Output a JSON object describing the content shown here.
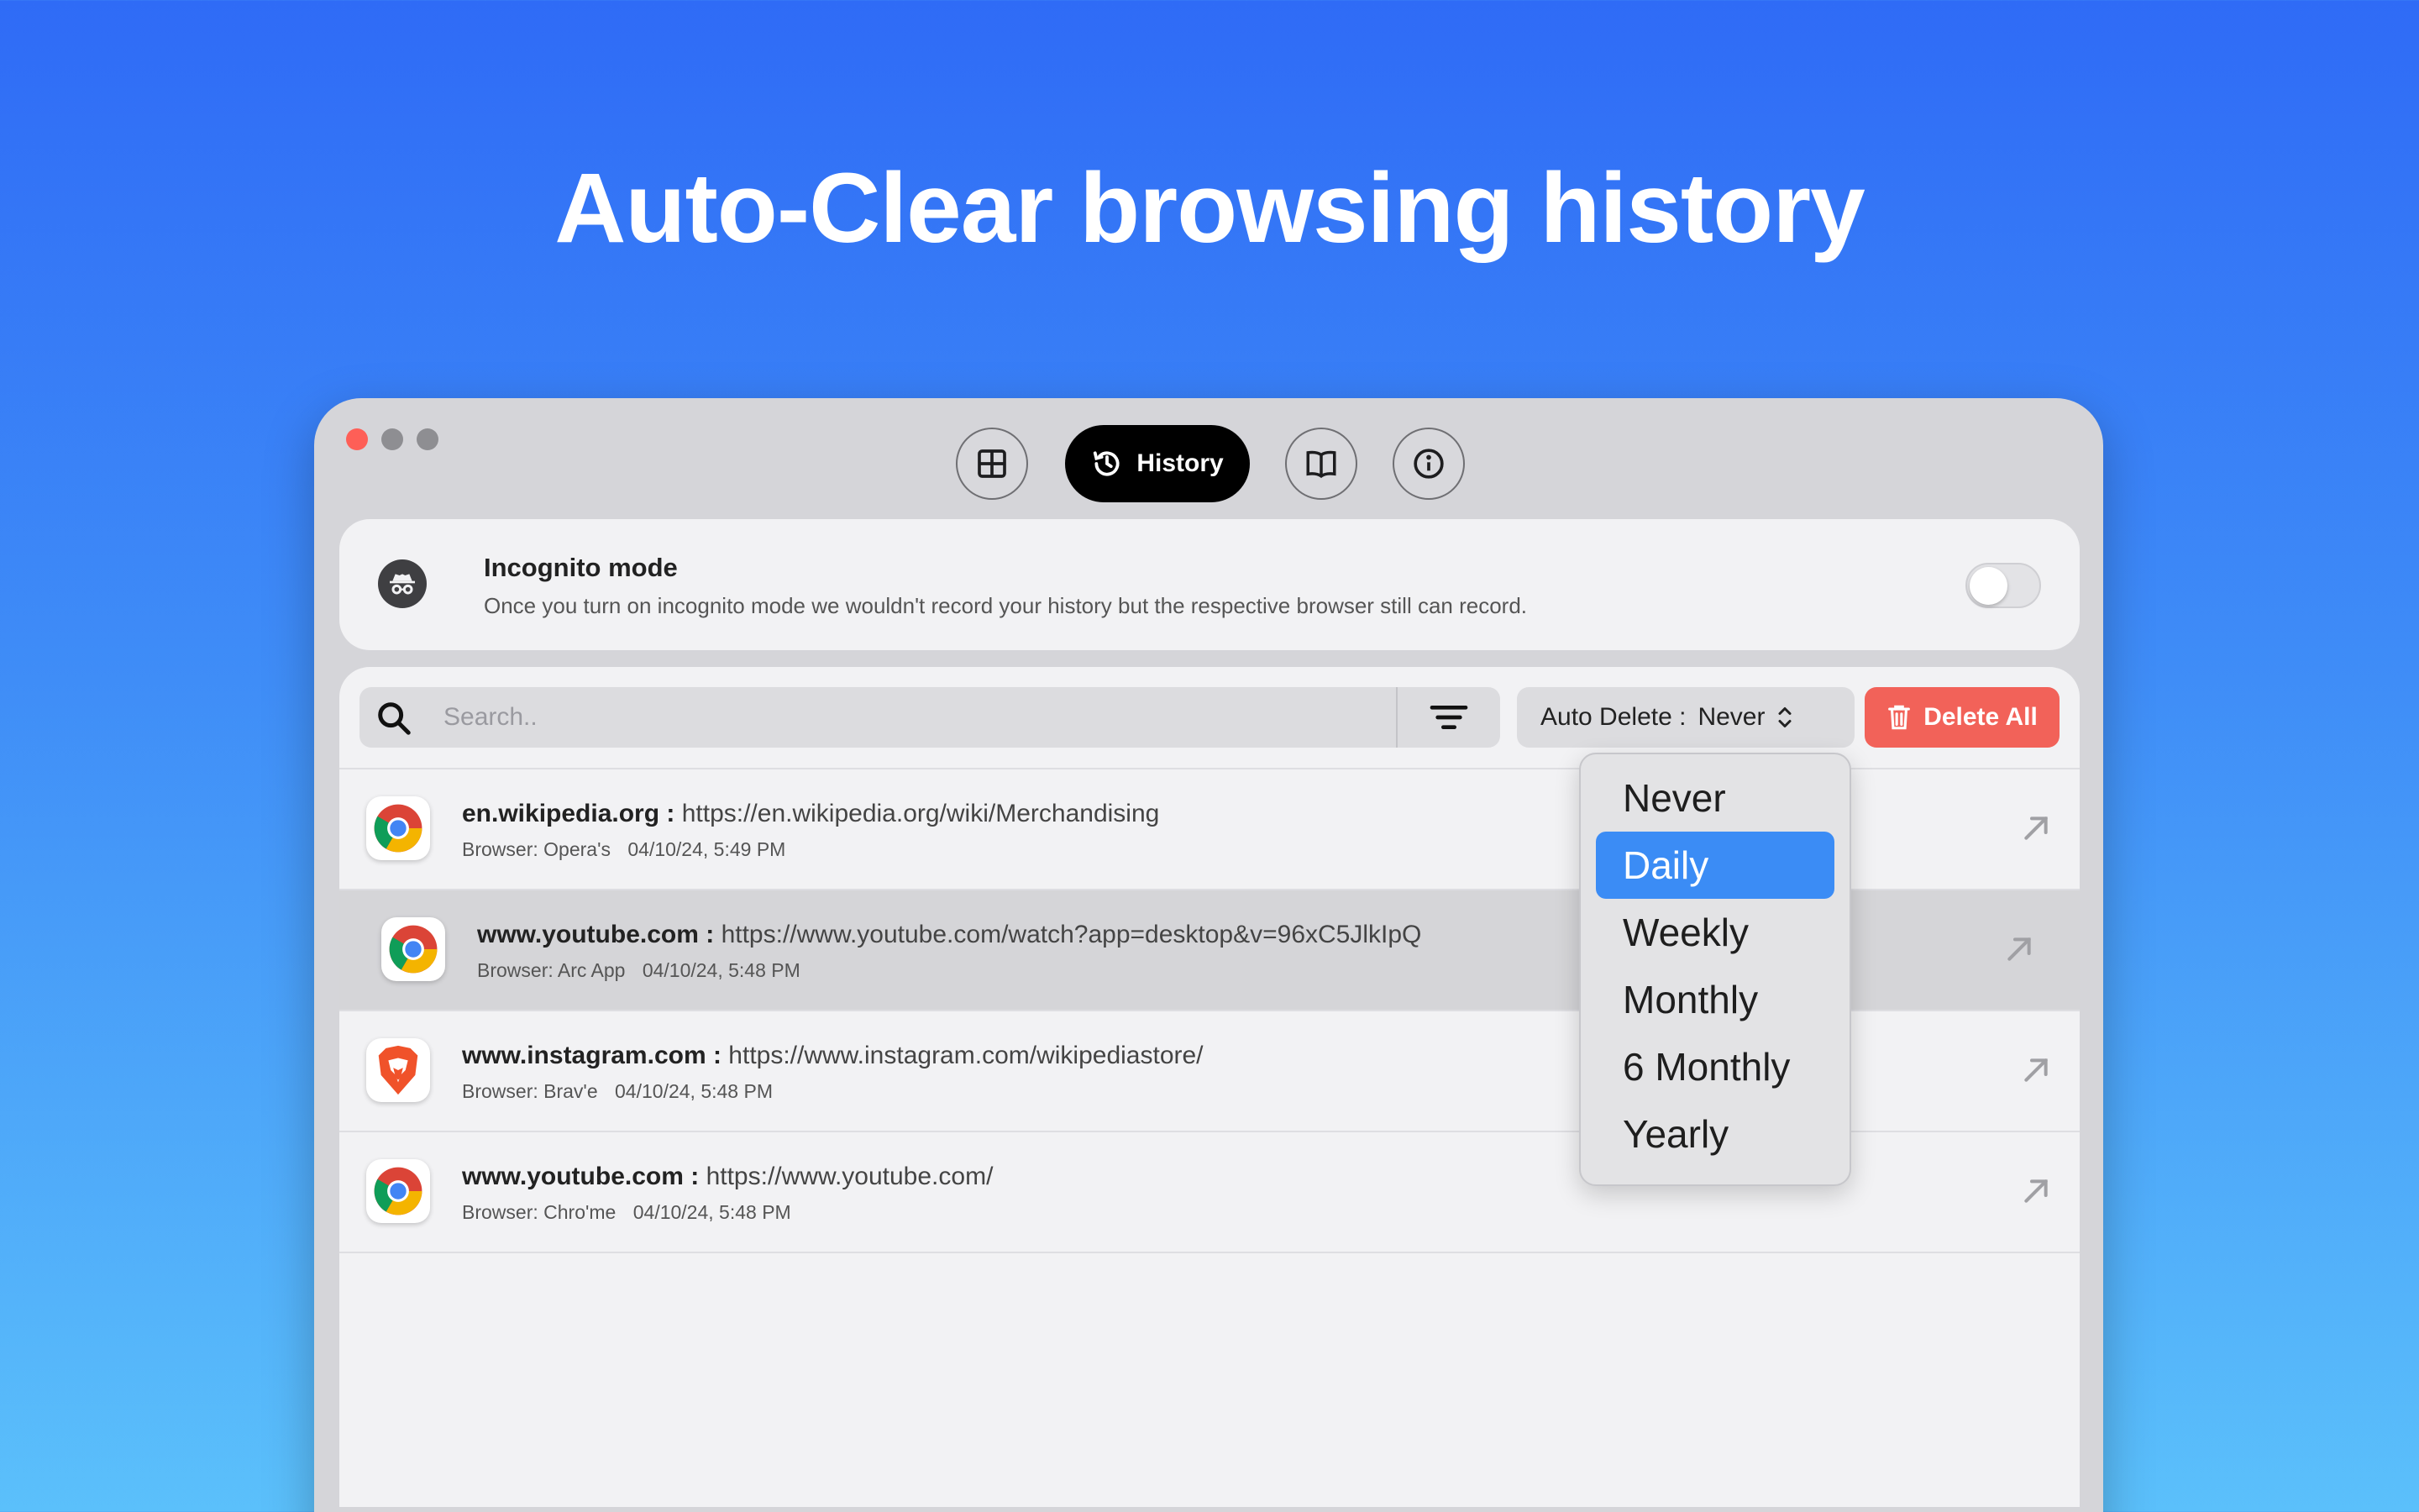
{
  "headline": "Auto-Clear browsing history",
  "colors": {
    "accent": "#3b8cf5",
    "danger": "#f26259",
    "close": "#fe5f57"
  },
  "tabs": [
    {
      "icon": "grid-icon"
    },
    {
      "icon": "history-icon",
      "label": "History",
      "active": true
    },
    {
      "icon": "book-icon"
    },
    {
      "icon": "info-icon"
    }
  ],
  "incognito": {
    "title": "Incognito mode",
    "description": "Once you turn on incognito mode we wouldn't record your history but the respective browser still can record.",
    "enabled": false
  },
  "toolbar": {
    "search_placeholder": "Search..",
    "auto_delete_label": "Auto Delete :",
    "auto_delete_value": "Never",
    "delete_all_label": "Delete All"
  },
  "history": [
    {
      "domain": "en.wikipedia.org :",
      "url": "https://en.wikipedia.org/wiki/Merchandising",
      "browser_label": "Browser:",
      "browser": "Opera's",
      "time": "04/10/24, 5:49 PM",
      "icon": "chrome-icon"
    },
    {
      "domain": "www.youtube.com :",
      "url": "https://www.youtube.com/watch?app=desktop&v=96xC5JlkIpQ",
      "browser_label": "Browser:",
      "browser": "Arc App",
      "time": "04/10/24, 5:48 PM",
      "icon": "chrome-icon"
    },
    {
      "domain": "www.instagram.com :",
      "url": "https://www.instagram.com/wikipediastore/",
      "browser_label": "Browser:",
      "browser": "Brav'e",
      "time": "04/10/24, 5:48 PM",
      "icon": "brave-icon"
    },
    {
      "domain": "www.youtube.com :",
      "url": "https://www.youtube.com/",
      "browser_label": "Browser:",
      "browser": "Chro'me",
      "time": "04/10/24, 5:48 PM",
      "icon": "chrome-icon"
    }
  ],
  "dropdown": {
    "options": [
      "Never",
      "Daily",
      "Weekly",
      "Monthly",
      "6 Monthly",
      "Yearly"
    ],
    "selected": "Daily"
  }
}
